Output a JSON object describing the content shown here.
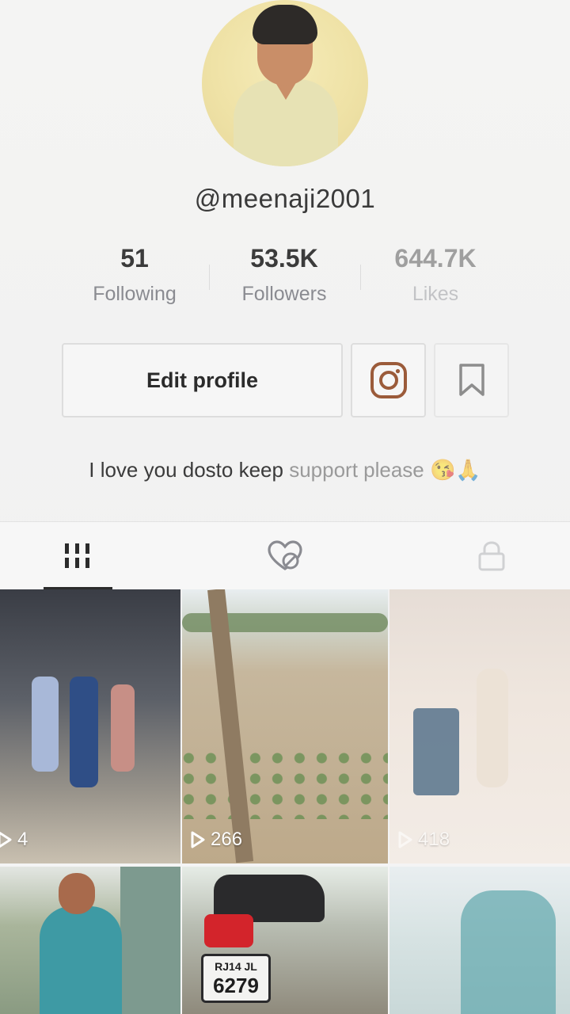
{
  "profile": {
    "username": "@meenaji2001",
    "bio_main": "I love you dosto keep ",
    "bio_fade": "support please",
    "bio_emoji": " 😘🙏"
  },
  "stats": [
    {
      "value": "51",
      "label": "Following"
    },
    {
      "value": "53.5K",
      "label": "Followers"
    },
    {
      "value": "644.7K",
      "label": "Likes"
    }
  ],
  "actions": {
    "edit_profile": "Edit profile",
    "instagram_icon": "instagram-icon",
    "bookmark_icon": "bookmark-icon"
  },
  "tabs": [
    {
      "name": "videos",
      "icon": "grid-icon",
      "active": true
    },
    {
      "name": "liked",
      "icon": "heart-hidden-icon",
      "active": false
    },
    {
      "name": "private",
      "icon": "lock-icon",
      "active": false
    }
  ],
  "videos": [
    {
      "views": "4"
    },
    {
      "views": "266"
    },
    {
      "views": "418"
    },
    {
      "views": ""
    },
    {
      "views": "",
      "plate_line1": "RJ14 JL",
      "plate_line2": "6279"
    },
    {
      "views": ""
    }
  ],
  "colors": {
    "text_primary": "#161823",
    "text_secondary": "#8a8b91",
    "instagram": "#9b5b3a"
  }
}
